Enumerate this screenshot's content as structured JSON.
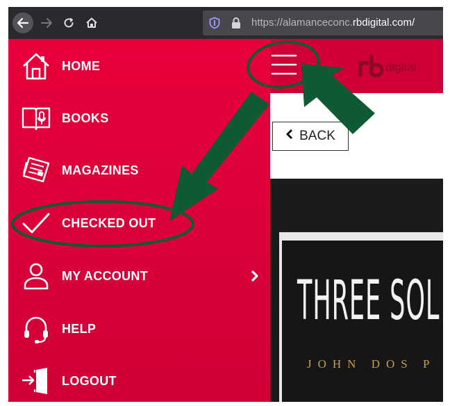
{
  "browser": {
    "url_prefix": "https://alamanceconc.",
    "url_domain": "rbdigital.com/",
    "back_icon": "arrow-left-icon",
    "forward_icon": "arrow-right-icon",
    "reload_icon": "reload-icon",
    "home_icon": "home-icon"
  },
  "sidebar": {
    "items": [
      {
        "label": "HOME",
        "icon": "house-icon"
      },
      {
        "label": "BOOKS",
        "icon": "book-icon"
      },
      {
        "label": "MAGAZINES",
        "icon": "magazine-icon"
      },
      {
        "label": "CHECKED OUT",
        "icon": "checkmark-icon"
      },
      {
        "label": "MY ACCOUNT",
        "icon": "person-icon"
      },
      {
        "label": "HELP",
        "icon": "headset-icon"
      },
      {
        "label": "LOGOUT",
        "icon": "door-icon"
      }
    ]
  },
  "header": {
    "menu_icon": "hamburger-menu-icon",
    "logo_text": "digital"
  },
  "main": {
    "back_label": "BACK",
    "cover_title": "THREE SOL",
    "cover_author": "JOHN DOS P"
  },
  "colors": {
    "brand_red": "#e8003b",
    "annotation_green": "#0e5a32"
  }
}
